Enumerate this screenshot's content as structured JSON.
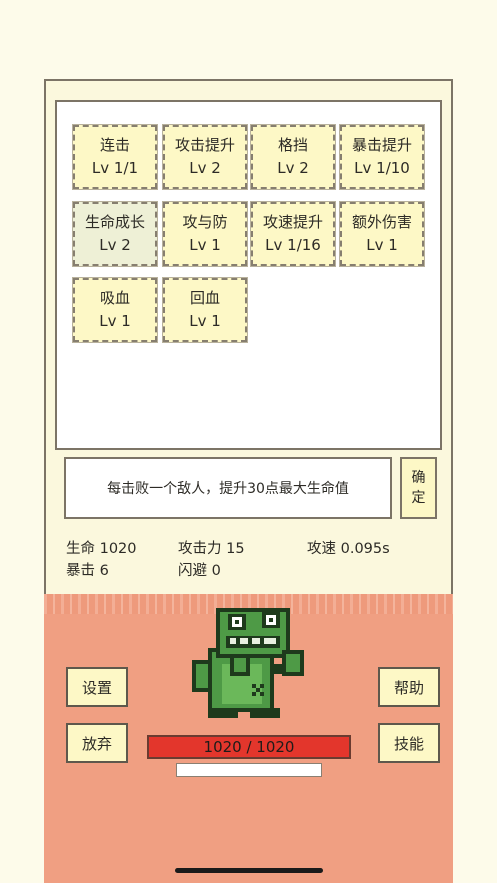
{
  "skills": [
    {
      "name": "连击",
      "level": "Lv 1/1"
    },
    {
      "name": "攻击提升",
      "level": "Lv 2"
    },
    {
      "name": "格挡",
      "level": "Lv 2"
    },
    {
      "name": "暴击提升",
      "level": "Lv 1/10"
    },
    {
      "name": "生命成长",
      "level": "Lv 2",
      "selected": true
    },
    {
      "name": "攻与防",
      "level": "Lv 1"
    },
    {
      "name": "攻速提升",
      "level": "Lv 1/16"
    },
    {
      "name": "额外伤害",
      "level": "Lv 1"
    },
    {
      "name": "吸血",
      "level": "Lv 1"
    },
    {
      "name": "回血",
      "level": "Lv 1"
    }
  ],
  "description": "每击败一个敌人，提升30点最大生命值",
  "confirm_label": "确定",
  "stats": {
    "hp": "生命 1020",
    "attack": "攻击力 15",
    "attack_speed": "攻速 0.095s",
    "crit": "暴击 6",
    "dodge": "闪避 0"
  },
  "buttons": {
    "settings": "设置",
    "give_up": "放弃",
    "help": "帮助",
    "skills": "技能"
  },
  "hp_bar": {
    "text": "1020 / 1020",
    "fraction": 1.0
  },
  "xp_bar": {
    "fraction": 0.0
  },
  "icons": {
    "character": "green-frog-fighter-icon"
  },
  "colors": {
    "hp": "#e3362c",
    "arena": "#f09f82",
    "card": "#fdf8c6",
    "frog": "#4e9a46"
  }
}
